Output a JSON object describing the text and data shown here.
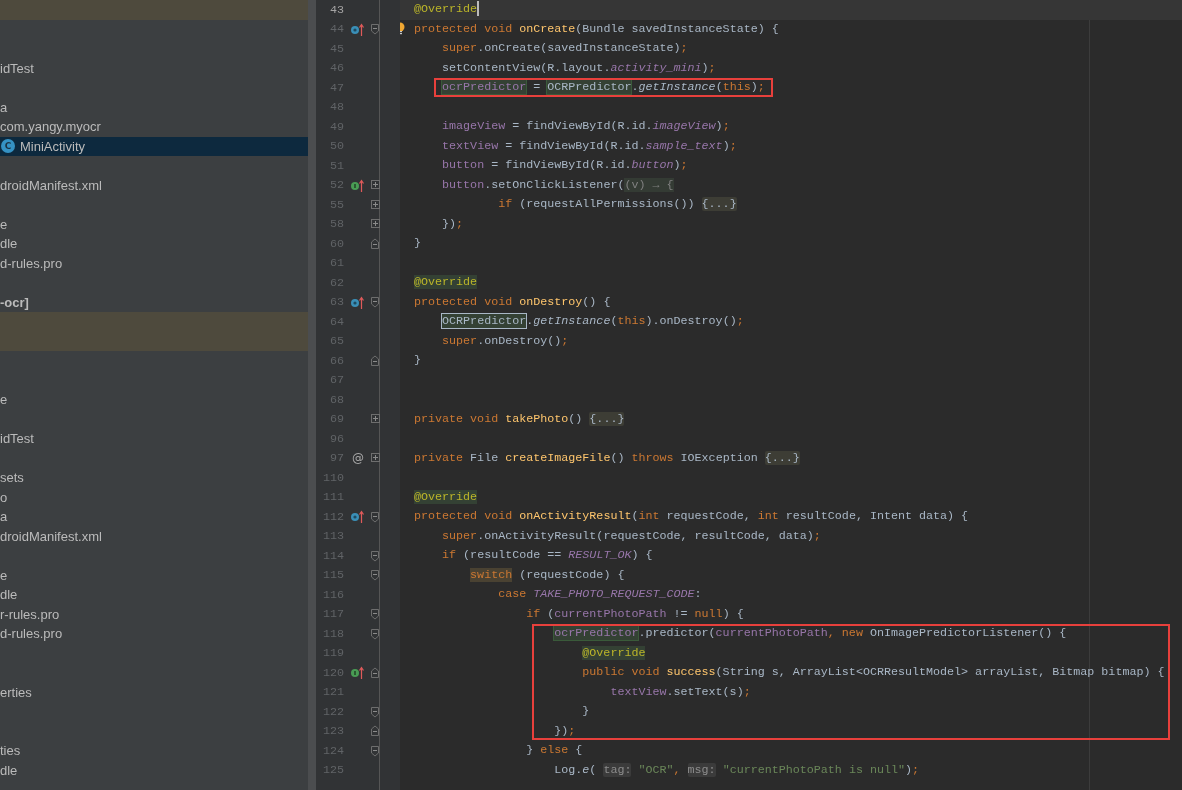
{
  "project_tree": {
    "rows": [
      {
        "kind": "band"
      },
      {
        "kind": "blank"
      },
      {
        "kind": "blank"
      },
      {
        "kind": "item",
        "label": "idTest",
        "selected": false
      },
      {
        "kind": "blank"
      },
      {
        "kind": "item",
        "label": "a",
        "selected": false
      },
      {
        "kind": "item",
        "label": "com.yangy.myocr",
        "selected": false
      },
      {
        "kind": "class",
        "label": "MiniActivity",
        "icon_letter": "C",
        "selected": true
      },
      {
        "kind": "blank"
      },
      {
        "kind": "item",
        "label": "droidManifest.xml",
        "selected": false
      },
      {
        "kind": "blank"
      },
      {
        "kind": "item",
        "label": "e",
        "selected": false
      },
      {
        "kind": "item",
        "label": "dle",
        "selected": false
      },
      {
        "kind": "item",
        "label": "d-rules.pro",
        "selected": false
      },
      {
        "kind": "blank"
      },
      {
        "kind": "module",
        "label": "-ocr]",
        "selected": false
      },
      {
        "kind": "band"
      },
      {
        "kind": "band"
      },
      {
        "kind": "blank"
      },
      {
        "kind": "blank"
      },
      {
        "kind": "item",
        "label": "e",
        "selected": false
      },
      {
        "kind": "blank"
      },
      {
        "kind": "item",
        "label": "idTest",
        "selected": false
      },
      {
        "kind": "blank"
      },
      {
        "kind": "item",
        "label": "sets",
        "selected": false
      },
      {
        "kind": "item",
        "label": "o",
        "selected": false
      },
      {
        "kind": "item",
        "label": "a",
        "selected": false
      },
      {
        "kind": "item",
        "label": "droidManifest.xml",
        "selected": false
      },
      {
        "kind": "blank"
      },
      {
        "kind": "item",
        "label": "e",
        "selected": false
      },
      {
        "kind": "item",
        "label": "dle",
        "selected": false
      },
      {
        "kind": "item",
        "label": "r-rules.pro",
        "selected": false
      },
      {
        "kind": "item",
        "label": "d-rules.pro",
        "selected": false
      },
      {
        "kind": "blank"
      },
      {
        "kind": "blank"
      },
      {
        "kind": "item",
        "label": "erties",
        "selected": false
      },
      {
        "kind": "blank"
      },
      {
        "kind": "blank"
      },
      {
        "kind": "item",
        "label": "ties",
        "selected": false
      },
      {
        "kind": "item",
        "label": "dle",
        "selected": false
      }
    ]
  },
  "code_lines": [
    {
      "number": "43",
      "current": true,
      "tokens": [
        {
          "kind": "annotation",
          "text": "@Override"
        }
      ]
    },
    {
      "number": "44",
      "marker": {
        "kind": "override"
      },
      "fold": {
        "kind": "open"
      },
      "intention": {
        "kind": "bulb"
      },
      "current": false,
      "tokens": [
        {
          "kind": "keyword",
          "text": "protected void "
        },
        {
          "kind": "method",
          "text": "onCreate"
        },
        {
          "kind": "plain",
          "text": "(Bundle savedInstanceState) {"
        }
      ]
    },
    {
      "number": "45",
      "current": false,
      "tokens": [
        {
          "kind": "keyword",
          "text": "    super"
        },
        {
          "kind": "plain",
          "text": ".onCreate(savedInstanceState)"
        },
        {
          "kind": "keyword",
          "text": ";"
        }
      ]
    },
    {
      "number": "46",
      "current": false,
      "tokens": [
        {
          "kind": "plain",
          "text": "    setContentView(R.layout."
        },
        {
          "kind": "constant",
          "text": "activity_mini"
        },
        {
          "kind": "plain",
          "text": ")"
        },
        {
          "kind": "keyword",
          "text": ";"
        }
      ]
    },
    {
      "number": "47",
      "frame": {
        "kind": "outline"
      },
      "current": false,
      "tokens": [
        {
          "kind": "fieldusage",
          "text": "    ocrPredictor"
        },
        {
          "kind": "plain",
          "text": " = "
        },
        {
          "kind": "typeusage",
          "text": "OCRPredictor"
        },
        {
          "kind": "plain",
          "text": "."
        },
        {
          "kind": "italic",
          "text": "getInstance"
        },
        {
          "kind": "plain",
          "text": "("
        },
        {
          "kind": "keyword",
          "text": "this"
        },
        {
          "kind": "plain",
          "text": ")"
        },
        {
          "kind": "keyword",
          "text": ";"
        }
      ]
    },
    {
      "number": "48",
      "current": false
    },
    {
      "number": "49",
      "current": false,
      "tokens": [
        {
          "kind": "field",
          "text": "    imageView"
        },
        {
          "kind": "plain",
          "text": " = findViewById(R.id."
        },
        {
          "kind": "constant",
          "text": "imageView"
        },
        {
          "kind": "plain",
          "text": ")"
        },
        {
          "kind": "keyword",
          "text": ";"
        }
      ]
    },
    {
      "number": "50",
      "current": false,
      "tokens": [
        {
          "kind": "field",
          "text": "    textView"
        },
        {
          "kind": "plain",
          "text": " = findViewById(R.id."
        },
        {
          "kind": "constant",
          "text": "sample_text"
        },
        {
          "kind": "plain",
          "text": ")"
        },
        {
          "kind": "keyword",
          "text": ";"
        }
      ]
    },
    {
      "number": "51",
      "current": false,
      "tokens": [
        {
          "kind": "field",
          "text": "    button"
        },
        {
          "kind": "plain",
          "text": " = findViewById(R.id."
        },
        {
          "kind": "constant",
          "text": "button"
        },
        {
          "kind": "plain",
          "text": ")"
        },
        {
          "kind": "keyword",
          "text": ";"
        }
      ]
    },
    {
      "number": "52",
      "marker": {
        "kind": "implement"
      },
      "fold": {
        "kind": "folded"
      },
      "current": false,
      "tokens": [
        {
          "kind": "field",
          "text": "    button"
        },
        {
          "kind": "plain",
          "text": ".setOnClickListener("
        },
        {
          "kind": "lambda",
          "text": "(v) → {"
        }
      ]
    },
    {
      "number": "55",
      "fold": {
        "kind": "folded"
      },
      "current": false,
      "tokens": [
        {
          "kind": "keyword",
          "text": "            if"
        },
        {
          "kind": "plain",
          "text": " (requestAllPermissions()) "
        },
        {
          "kind": "folded",
          "text": "{...}"
        }
      ]
    },
    {
      "number": "58",
      "fold": {
        "kind": "folded"
      },
      "current": false,
      "tokens": [
        {
          "kind": "plain",
          "text": "    })"
        },
        {
          "kind": "keyword",
          "text": ";"
        }
      ]
    },
    {
      "number": "60",
      "fold": {
        "kind": "end"
      },
      "current": false,
      "tokens": [
        {
          "kind": "plain",
          "text": "}"
        }
      ]
    },
    {
      "number": "61",
      "current": false
    },
    {
      "number": "62",
      "current": false,
      "tokens": [
        {
          "kind": "annousage",
          "text": "@Override"
        }
      ]
    },
    {
      "number": "63",
      "marker": {
        "kind": "override"
      },
      "fold": {
        "kind": "open"
      },
      "current": false,
      "tokens": [
        {
          "kind": "keyword",
          "text": "protected void "
        },
        {
          "kind": "method",
          "text": "onDestroy"
        },
        {
          "kind": "plain",
          "text": "() {"
        }
      ]
    },
    {
      "number": "64",
      "current": false,
      "tokens": [
        {
          "kind": "typecaret",
          "text": "    OCRPredictor"
        },
        {
          "kind": "plain",
          "text": "."
        },
        {
          "kind": "italic",
          "text": "getInstance"
        },
        {
          "kind": "plain",
          "text": "("
        },
        {
          "kind": "keyword",
          "text": "this"
        },
        {
          "kind": "plain",
          "text": ").onDestroy()"
        },
        {
          "kind": "keyword",
          "text": ";"
        }
      ]
    },
    {
      "number": "65",
      "current": false,
      "tokens": [
        {
          "kind": "keyword",
          "text": "    super"
        },
        {
          "kind": "plain",
          "text": ".onDestroy()"
        },
        {
          "kind": "keyword",
          "text": ";"
        }
      ]
    },
    {
      "number": "66",
      "fold": {
        "kind": "end"
      },
      "current": false,
      "tokens": [
        {
          "kind": "plain",
          "text": "}"
        }
      ]
    },
    {
      "number": "67",
      "current": false
    },
    {
      "number": "68",
      "current": false
    },
    {
      "number": "69",
      "fold": {
        "kind": "folded"
      },
      "current": false,
      "tokens": [
        {
          "kind": "keyword",
          "text": "private void "
        },
        {
          "kind": "method",
          "text": "takePhoto"
        },
        {
          "kind": "plain",
          "text": "() "
        },
        {
          "kind": "folded",
          "text": "{...}"
        }
      ]
    },
    {
      "number": "96",
      "current": false
    },
    {
      "number": "97",
      "marker": {
        "kind": "glyph",
        "text": "@"
      },
      "fold": {
        "kind": "folded"
      },
      "current": false,
      "tokens": [
        {
          "kind": "keyword",
          "text": "private "
        },
        {
          "kind": "plain",
          "text": "File "
        },
        {
          "kind": "method",
          "text": "createImageFile"
        },
        {
          "kind": "plain",
          "text": "() "
        },
        {
          "kind": "keyword",
          "text": "throws "
        },
        {
          "kind": "plain",
          "text": "IOException "
        },
        {
          "kind": "folded",
          "text": "{...}"
        }
      ]
    },
    {
      "number": "110",
      "current": false
    },
    {
      "number": "111",
      "current": false,
      "tokens": [
        {
          "kind": "annousage",
          "text": "@Override"
        }
      ]
    },
    {
      "number": "112",
      "marker": {
        "kind": "override"
      },
      "fold": {
        "kind": "open"
      },
      "current": false,
      "tokens": [
        {
          "kind": "keyword",
          "text": "protected void "
        },
        {
          "kind": "method",
          "text": "onActivityResult"
        },
        {
          "kind": "plain",
          "text": "("
        },
        {
          "kind": "keyword",
          "text": "int "
        },
        {
          "kind": "plain",
          "text": "requestCode, "
        },
        {
          "kind": "keyword",
          "text": "int "
        },
        {
          "kind": "plain",
          "text": "resultCode, Intent data) {"
        }
      ]
    },
    {
      "number": "113",
      "current": false,
      "tokens": [
        {
          "kind": "keyword",
          "text": "    super"
        },
        {
          "kind": "plain",
          "text": ".onActivityResult(requestCode, resultCode, data)"
        },
        {
          "kind": "keyword",
          "text": ";"
        }
      ]
    },
    {
      "number": "114",
      "fold": {
        "kind": "open"
      },
      "current": false,
      "tokens": [
        {
          "kind": "keyword",
          "text": "    if "
        },
        {
          "kind": "plain",
          "text": "(resultCode == "
        },
        {
          "kind": "constant",
          "text": "RESULT_OK"
        },
        {
          "kind": "plain",
          "text": ") {"
        }
      ]
    },
    {
      "number": "115",
      "fold": {
        "kind": "open"
      },
      "current": false,
      "tokens": [
        {
          "kind": "keyusage",
          "text": "        switch"
        },
        {
          "kind": "plain",
          "text": " (requestCode) {"
        }
      ]
    },
    {
      "number": "116",
      "current": false,
      "tokens": [
        {
          "kind": "keyword",
          "text": "            case "
        },
        {
          "kind": "constant",
          "text": "TAKE_PHOTO_REQUEST_CODE"
        },
        {
          "kind": "plain",
          "text": ":"
        }
      ]
    },
    {
      "number": "117",
      "fold": {
        "kind": "open"
      },
      "current": false,
      "tokens": [
        {
          "kind": "keyword",
          "text": "                if "
        },
        {
          "kind": "plain",
          "text": "("
        },
        {
          "kind": "field",
          "text": "currentPhotoPath"
        },
        {
          "kind": "plain",
          "text": " != "
        },
        {
          "kind": "keyword",
          "text": "null"
        },
        {
          "kind": "plain",
          "text": ") {"
        }
      ]
    },
    {
      "number": "118",
      "fold": {
        "kind": "open"
      },
      "frame": {
        "kind": "outline"
      },
      "current": false,
      "tokens": [
        {
          "kind": "fieldusage",
          "text": "                    ocrPredictor"
        },
        {
          "kind": "plain",
          "text": ".predictor("
        },
        {
          "kind": "field",
          "text": "currentPhotoPath"
        },
        {
          "kind": "keyword",
          "text": ", new "
        },
        {
          "kind": "plain",
          "text": "OnImagePredictorListener() {"
        }
      ]
    },
    {
      "number": "119",
      "frame": {
        "kind": "outline"
      },
      "current": false,
      "tokens": [
        {
          "kind": "annousage",
          "text": "                        @Override"
        }
      ]
    },
    {
      "number": "120",
      "marker": {
        "kind": "implement"
      },
      "fold": {
        "kind": "end"
      },
      "frame": {
        "kind": "outline"
      },
      "current": false,
      "tokens": [
        {
          "kind": "keyword",
          "text": "                        public void "
        },
        {
          "kind": "method",
          "text": "success"
        },
        {
          "kind": "plain",
          "text": "(String s, ArrayList<OCRResultModel> arrayList, Bitmap bitmap) {"
        }
      ]
    },
    {
      "number": "121",
      "frame": {
        "kind": "outline"
      },
      "current": false,
      "tokens": [
        {
          "kind": "field",
          "text": "                            textView"
        },
        {
          "kind": "plain",
          "text": ".setText(s)"
        },
        {
          "kind": "keyword",
          "text": ";"
        }
      ]
    },
    {
      "number": "122",
      "fold": {
        "kind": "open"
      },
      "frame": {
        "kind": "outline"
      },
      "current": false,
      "tokens": [
        {
          "kind": "plain",
          "text": "                        }"
        }
      ]
    },
    {
      "number": "123",
      "fold": {
        "kind": "end"
      },
      "frame": {
        "kind": "outline"
      },
      "current": false,
      "tokens": [
        {
          "kind": "plain",
          "text": "                    })"
        },
        {
          "kind": "keyword",
          "text": ";"
        }
      ]
    },
    {
      "number": "124",
      "fold": {
        "kind": "open"
      },
      "current": false,
      "tokens": [
        {
          "kind": "plain",
          "text": "                } "
        },
        {
          "kind": "keyword",
          "text": "else"
        },
        {
          "kind": "plain",
          "text": " {"
        }
      ]
    },
    {
      "number": "125",
      "current": false,
      "tokens": [
        {
          "kind": "plain",
          "text": "                    Log."
        },
        {
          "kind": "italic",
          "text": "e"
        },
        {
          "kind": "plain",
          "text": "( "
        },
        {
          "kind": "hint",
          "text": "tag:"
        },
        {
          "kind": "string",
          "text": " \"OCR\""
        },
        {
          "kind": "keyword",
          "text": ", "
        },
        {
          "kind": "hint",
          "text": "msg:"
        },
        {
          "kind": "string",
          "text": " \"currentPhotoPath is null\""
        },
        {
          "kind": "plain",
          "text": ")"
        },
        {
          "kind": "keyword",
          "text": ";"
        }
      ]
    }
  ]
}
